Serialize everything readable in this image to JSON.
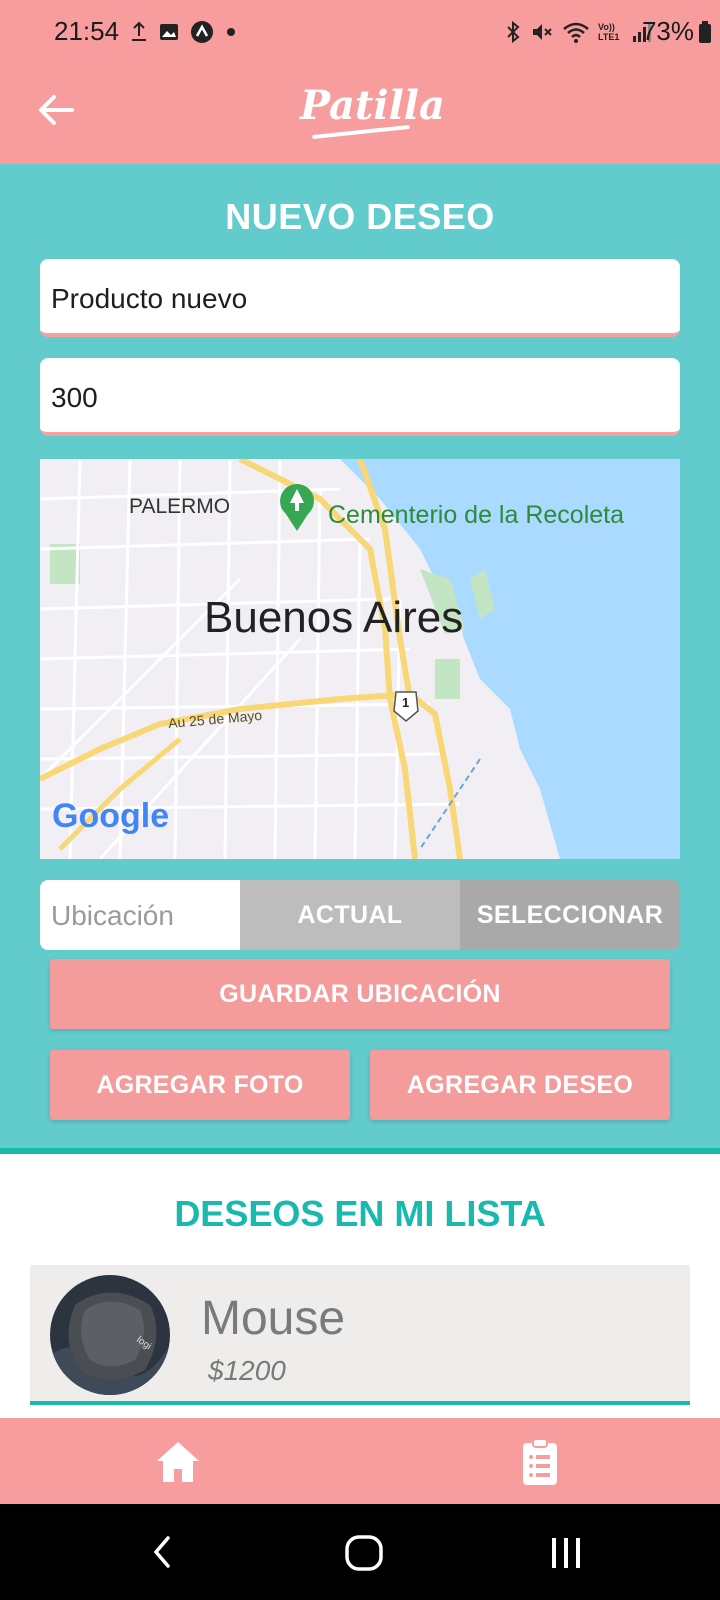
{
  "status_bar": {
    "time": "21:54",
    "battery": "73%",
    "icons": [
      "upload-icon",
      "image-icon",
      "app-icon",
      "dot-icon",
      "bluetooth-icon",
      "mute-icon",
      "wifi-icon",
      "volte-icon",
      "signal-icon",
      "battery-icon"
    ],
    "volte_text": "Vo)) LTE1"
  },
  "app_bar": {
    "logo": "Patilla",
    "back_icon": "arrow-left-icon"
  },
  "form": {
    "title": "NUEVO DESEO",
    "name_value": "Producto nuevo",
    "price_value": "300",
    "location_placeholder": "Ubicación",
    "actual_label": "ACTUAL",
    "select_label": "SELECCIONAR",
    "save_location_label": "GUARDAR UBICACIÓN",
    "add_photo_label": "AGREGAR FOTO",
    "add_wish_label": "AGREGAR DESEO"
  },
  "map": {
    "city": "Buenos Aires",
    "neighborhood": "PALERMO",
    "poi": "Cementerio de la Recoleta",
    "road": "Au 25 de Mayo",
    "route_shield": "1",
    "provider": "Google",
    "colors": {
      "water": "#aadaff",
      "park": "#c3e5c4",
      "land": "#f1eff3",
      "highway": "#f8d777"
    }
  },
  "list": {
    "title": "DESEOS EN MI LISTA",
    "items": [
      {
        "name": "Mouse",
        "price": "$1200"
      }
    ]
  },
  "bottom_nav": {
    "items": [
      "home-icon",
      "clipboard-list-icon"
    ]
  },
  "system_nav": {
    "items": [
      "back-nav-icon",
      "home-nav-icon",
      "recents-nav-icon"
    ]
  },
  "colors": {
    "header_pink": "#f79d9d",
    "teal_bg": "#62cccd",
    "accent_teal": "#1ab9ad",
    "button_pink": "#f49b9b",
    "grey_button": "#bdbdbd",
    "dark_grey_button": "#a9a9a9"
  }
}
